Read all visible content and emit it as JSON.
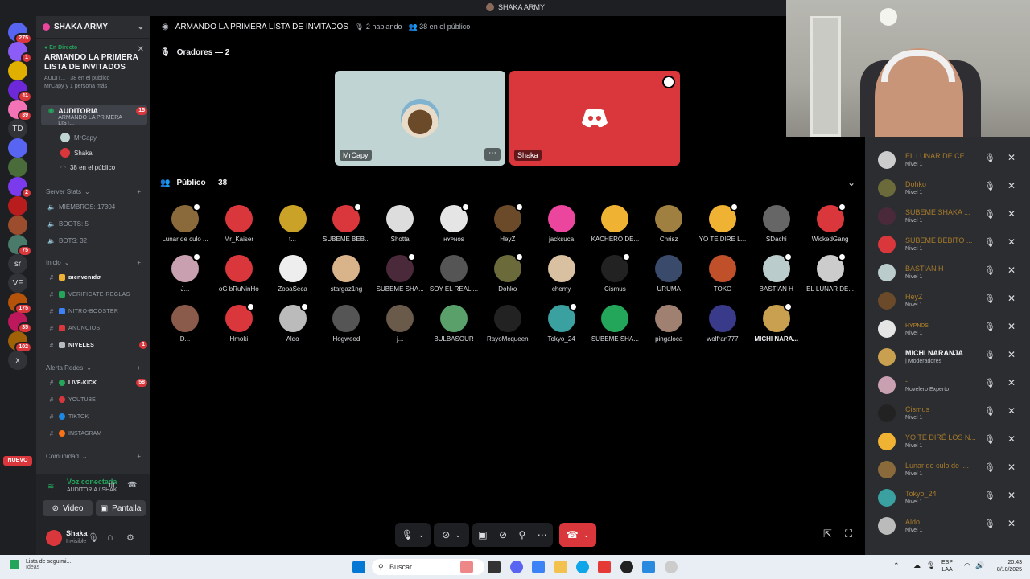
{
  "window": {
    "title": "SHAKA ARMY"
  },
  "rail": {
    "servers": [
      {
        "badge": "275",
        "color": "#5865f2"
      },
      {
        "badge": "1",
        "color": "#8b5cf6"
      },
      {
        "badge": "",
        "color": "#e0b000"
      },
      {
        "badge": "41",
        "color": "#6d28d9"
      },
      {
        "badge": "39",
        "color": "#f472b6"
      },
      {
        "label": "TD",
        "color": "#313338"
      },
      {
        "badge": "",
        "color": "#5865f2"
      },
      {
        "badge": "",
        "color": "#4a6b3a"
      },
      {
        "badge": "2",
        "color": "#7c3aed"
      },
      {
        "badge": "",
        "color": "#b91c1c"
      },
      {
        "badge": "",
        "color": "#9b4d2d"
      },
      {
        "badge": "75",
        "color": "#4a7a6a"
      },
      {
        "label": "sr",
        "color": "#313338"
      },
      {
        "label": "VF",
        "color": "#313338"
      },
      {
        "badge": "175",
        "color": "#b45309"
      },
      {
        "badge": "35",
        "color": "#be185d"
      },
      {
        "badge": "102",
        "color": "#a16207"
      },
      {
        "label": "x",
        "color": "#313338"
      }
    ],
    "new_label": "NUEVO"
  },
  "sidebar": {
    "guild_name": "SHAKA ARMY",
    "live": {
      "tag": "En Directo",
      "title": "ARMANDO LA PRIMERA LISTA DE INVITADOS",
      "sub1": "AUDIT...",
      "sub2": "38 en el público",
      "sub3": "MrCapy y 1 persona más"
    },
    "active_channel": {
      "name": "AUDITORIA",
      "badge": "15",
      "topic": "ARMANDO LA PRIMERA LIST..."
    },
    "speakers": [
      "MrCapy",
      "Shaka"
    ],
    "audience_count": "38 en el público",
    "categories": {
      "stats": "Server Stats",
      "inicio": "Inicio",
      "alerta": "Alerta Redes",
      "comunidad": "Comunidad"
    },
    "stats": [
      "MIEMBROS: 17304",
      "BOOTS: 5",
      "BOTS: 32"
    ],
    "inicio_channels": [
      {
        "name": "вιєnvєnιdσ",
        "badge": ""
      },
      {
        "name": "VERIFICATE-REGLAS",
        "badge": ""
      },
      {
        "name": "NITRO-BOOSTER",
        "badge": ""
      },
      {
        "name": "ANUNCIOS",
        "badge": ""
      },
      {
        "name": "NIVELES",
        "badge": "1"
      }
    ],
    "alerta_channels": [
      {
        "name": "LIVE-KICK",
        "badge": "58",
        "color": "#23a55a"
      },
      {
        "name": "YOUTUBE",
        "badge": "",
        "color": "#da373c"
      },
      {
        "name": "TIKTOK",
        "badge": "",
        "color": "#1e88e5"
      },
      {
        "name": "INSTAGRAM",
        "badge": "",
        "color": "#f97316"
      }
    ]
  },
  "voice_panel": {
    "connected": "Voz conectada",
    "channel": "AUDITORIA / SHAK...",
    "video_label": "Video",
    "screen_label": "Pantalla"
  },
  "user_panel": {
    "name": "Shaka",
    "status": "Invisible"
  },
  "stage": {
    "title": "ARMANDO LA PRIMERA LISTA DE INVITADOS",
    "speaking": "2 hablando",
    "audience_meta": "38 en el público",
    "speakers_header": "Oradores — 2",
    "audience_header": "Público — 38",
    "speaker_tiles": [
      {
        "name": "MrCapy",
        "bg": "#c0d4d4"
      },
      {
        "name": "Shaka",
        "bg": "#da373c"
      }
    ],
    "audience": [
      {
        "name": "Lunar de culo ...",
        "color": "#8a6a3a",
        "hand": true
      },
      {
        "name": "Mr_Kaiser",
        "color": "#da373c",
        "hand": false
      },
      {
        "name": "t...",
        "color": "#c9a227",
        "hand": false
      },
      {
        "name": "SUBEME BEB...",
        "color": "#da373c",
        "hand": true
      },
      {
        "name": "Shotta",
        "color": "#ddd",
        "hand": false
      },
      {
        "name": "ʜʏᴘɴᴏs",
        "color": "#e5e5e5",
        "hand": true
      },
      {
        "name": "HeyZ",
        "color": "#6b4a2a",
        "hand": true
      },
      {
        "name": "jacksuca",
        "color": "#eb459e",
        "hand": false
      },
      {
        "name": "KACHERO DE...",
        "color": "#f0b232",
        "hand": false
      },
      {
        "name": "Chrisz",
        "color": "#a08040",
        "hand": false
      },
      {
        "name": "YO TE DIRÉ L...",
        "color": "#f0b232",
        "hand": true
      },
      {
        "name": "SDachi",
        "color": "#666",
        "hand": false
      },
      {
        "name": "WickedGang",
        "color": "#da373c",
        "hand": true
      },
      {
        "name": "J...",
        "color": "#c9a0b0",
        "hand": true
      },
      {
        "name": "oG bRuNinHo",
        "color": "#da373c",
        "hand": false
      },
      {
        "name": "ZopaSeca",
        "color": "#eee",
        "hand": false
      },
      {
        "name": "stargaz1ng",
        "color": "#d9b48a",
        "hand": false
      },
      {
        "name": "SUBEME SHA...",
        "color": "#4a2a3a",
        "hand": true
      },
      {
        "name": "SOY EL REAL ...",
        "color": "#555",
        "hand": false
      },
      {
        "name": "Dohko",
        "color": "#6a6a3a",
        "hand": true
      },
      {
        "name": "chemy",
        "color": "#d9c0a0",
        "hand": false
      },
      {
        "name": "Cismus",
        "color": "#222",
        "hand": true
      },
      {
        "name": "URUMA",
        "color": "#3a4a6a",
        "hand": false
      },
      {
        "name": "TOKO",
        "color": "#c0502a",
        "hand": false
      },
      {
        "name": "BASTIAN H",
        "color": "#bcc",
        "hand": true
      },
      {
        "name": "EL LUNAR DE...",
        "color": "#ccc",
        "hand": true
      },
      {
        "name": "D...",
        "color": "#8a5a4a",
        "hand": false
      },
      {
        "name": "Hmoki",
        "color": "#da373c",
        "hand": true
      },
      {
        "name": "Aldo",
        "color": "#bbb",
        "hand": true
      },
      {
        "name": "Hogweed",
        "color": "#555",
        "hand": false
      },
      {
        "name": "j...",
        "color": "#6a5a4a",
        "hand": false
      },
      {
        "name": "BULBASOUR",
        "color": "#5aa06a",
        "hand": false
      },
      {
        "name": "RayoMcqueen",
        "color": "#222",
        "hand": false
      },
      {
        "name": "Tokyo_24",
        "color": "#3aa0a0",
        "hand": true
      },
      {
        "name": "SUBEME SHA...",
        "color": "#23a55a",
        "hand": false
      },
      {
        "name": "pingaloca",
        "color": "#a08070",
        "hand": false
      },
      {
        "name": "wolfran777",
        "color": "#3a3a8a",
        "hand": false
      },
      {
        "name": "MICHI NARA...",
        "color": "#c9a050",
        "hand": true,
        "bold": true
      }
    ]
  },
  "member_list": [
    {
      "name": "EL LUNAR DE CE...",
      "level": "Nivel 1",
      "color": "#ccc"
    },
    {
      "name": "Dohko",
      "level": "Nivel 1",
      "color": "#6a6a3a"
    },
    {
      "name": "SUBEME SHAKA ...",
      "level": "Nivel 1",
      "color": "#4a2a3a"
    },
    {
      "name": "SUBEME BEBITO ...",
      "level": "Nivel 1",
      "color": "#da373c"
    },
    {
      "name": "BASTIAN H",
      "level": "Nivel 1",
      "color": "#bcc"
    },
    {
      "name": "HeyZ",
      "level": "Nivel 1",
      "color": "#6b4a2a"
    },
    {
      "name": "ʜʏᴘɴᴏs",
      "level": "Nivel 1",
      "color": "#e5e5e5"
    },
    {
      "name": "MICHI NARANJA",
      "level": "| Moderadores",
      "color": "#c9a050",
      "white": true
    },
    {
      "name": "-",
      "level": "Novelero Experto",
      "color": "#c9a0b0"
    },
    {
      "name": "Cismus",
      "level": "Nivel 1",
      "color": "#222"
    },
    {
      "name": "YO TE DIRÉ LOS N...",
      "level": "Nivel 1",
      "color": "#f0b232"
    },
    {
      "name": "Lunar de culo de l...",
      "level": "Nivel 1",
      "color": "#8a6a3a"
    },
    {
      "name": "Tokyo_24",
      "level": "Nivel 1",
      "color": "#3aa0a0"
    },
    {
      "name": "Aldo",
      "level": "Nivel 1",
      "color": "#bbb"
    }
  ],
  "taskbar": {
    "news_title": "Lista de seguimi...",
    "news_sub": "Ideas",
    "search_placeholder": "Buscar",
    "lang_top": "ESP",
    "lang_bottom": "LAA",
    "time": "20:43",
    "date": "8/10/2025"
  }
}
